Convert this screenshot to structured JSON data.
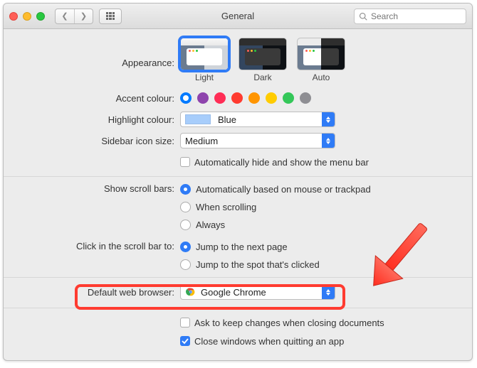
{
  "window_title": "General",
  "search_placeholder": "Search",
  "labels": {
    "appearance": "Appearance:",
    "accent": "Accent colour:",
    "highlight": "Highlight colour:",
    "sidebar": "Sidebar icon size:",
    "scrollbars": "Show scroll bars:",
    "scrollclick": "Click in the scroll bar to:",
    "browser": "Default web browser:"
  },
  "appearance": {
    "options": [
      {
        "name": "Light",
        "selected": true
      },
      {
        "name": "Dark",
        "selected": false
      },
      {
        "name": "Auto",
        "selected": false
      }
    ]
  },
  "accent_colors": [
    "#007aff",
    "#8e44ad",
    "#ff2d55",
    "#ff3b30",
    "#ff9500",
    "#ffcc00",
    "#34c759",
    "#8e8e93"
  ],
  "accent_selected_index": 0,
  "highlight_value": "Blue",
  "sidebar_value": "Medium",
  "auto_hide_menubar": "Automatically hide and show the menu bar",
  "auto_hide_checked": false,
  "scroll_options": [
    {
      "label": "Automatically based on mouse or trackpad",
      "checked": true
    },
    {
      "label": "When scrolling",
      "checked": false
    },
    {
      "label": "Always",
      "checked": false
    }
  ],
  "scroll_click_options": [
    {
      "label": "Jump to the next page",
      "checked": true
    },
    {
      "label": "Jump to the spot that's clicked",
      "checked": false
    }
  ],
  "browser_value": "Google Chrome",
  "ask_keep_changes": {
    "label": "Ask to keep changes when closing documents",
    "checked": false
  },
  "close_windows_quit": {
    "label": "Close windows when quitting an app",
    "checked": true
  }
}
